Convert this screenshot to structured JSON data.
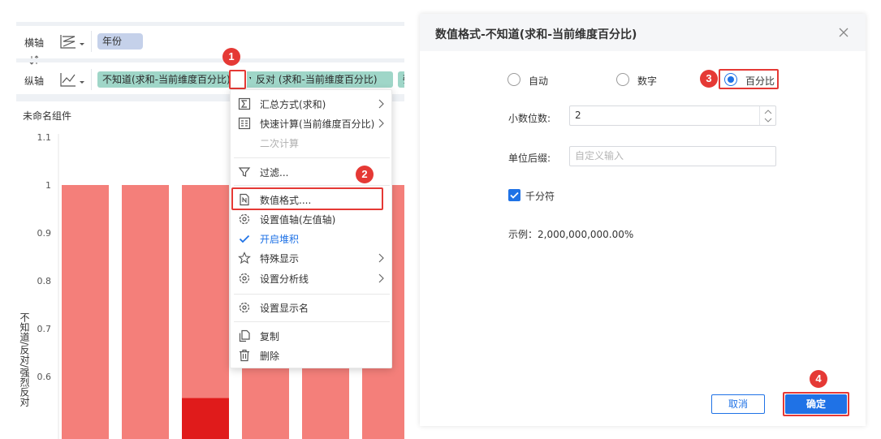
{
  "editor": {
    "x_axis_label": "横轴",
    "y_axis_label": "纵轴",
    "x_pills": [
      "年份"
    ],
    "y_pills": [
      "不知道(求和-当前维度百分比)",
      "反对 (求和-当前维度百分比)",
      "强"
    ],
    "component_title": "未命名组件"
  },
  "badges": [
    "1",
    "2",
    "3",
    "4"
  ],
  "menu": {
    "items": [
      {
        "label": "汇总方式(求和)",
        "icon": "sigma-icon",
        "submenu": true
      },
      {
        "label": "快速计算(当前维度百分比)",
        "icon": "calculator-icon",
        "submenu": true
      },
      {
        "label": "二次计算",
        "icon": "none",
        "disabled": true
      },
      {
        "label": "过滤...",
        "icon": "filter-icon"
      },
      {
        "label": "数值格式....",
        "icon": "number-format-icon"
      },
      {
        "label": "设置值轴(左值轴)",
        "icon": "gear-icon"
      },
      {
        "label": "开启堆积",
        "icon": "check-icon",
        "active": true
      },
      {
        "label": "特殊显示",
        "icon": "star-icon",
        "submenu": true
      },
      {
        "label": "设置分析线",
        "icon": "gear-icon",
        "submenu": true
      },
      {
        "label": "设置显示名",
        "icon": "gear-icon"
      },
      {
        "label": "复制",
        "icon": "copy-icon"
      },
      {
        "label": "删除",
        "icon": "trash-icon"
      }
    ]
  },
  "dialog": {
    "title": "数值格式-不知道(求和-当前维度百分比)",
    "radios": [
      {
        "label": "自动",
        "selected": false
      },
      {
        "label": "数字",
        "selected": false
      },
      {
        "label": "百分比",
        "selected": true
      }
    ],
    "decimal_label": "小数位数:",
    "decimal_value": "2",
    "suffix_label": "单位后缀:",
    "suffix_placeholder": "自定义输入",
    "thousands_label": "千分符",
    "thousands_checked": true,
    "example": "示例：2,000,000,000.00%",
    "cancel_label": "取消",
    "ok_label": "确定"
  },
  "colors": {
    "bar": "#f47f7a",
    "bar_highlight": "#e01b1b",
    "accent": "#1f72e6",
    "pill_green": "#9fd6c8",
    "pill_blue": "#c5d1ea",
    "badge": "#e53935"
  },
  "chart_data": {
    "type": "bar",
    "y_ticks": [
      "1.1",
      "1",
      "0.9",
      "0.8",
      "0.7",
      "0.6"
    ],
    "ylabel": "不知道/反对/强烈反对",
    "ylim": [
      0.55,
      1.1
    ],
    "series": [
      {
        "values": [
          1,
          1,
          1,
          1,
          1,
          1
        ]
      },
      {
        "values": [
          null,
          null,
          0.555,
          null,
          null,
          null
        ]
      }
    ]
  }
}
